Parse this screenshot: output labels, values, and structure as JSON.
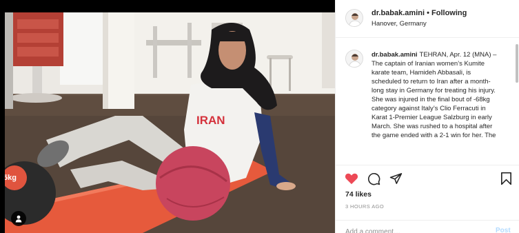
{
  "post": {
    "username": "dr.babak.amini",
    "separator": "•",
    "follow_status": "Following",
    "location": "Hanover, Germany",
    "caption_text": "TEHRAN, Apr. 12 (MNA) – The captain of Iranian women’s Kumite karate team, Hamideh Abbasali, is scheduled to return to Iran after a month-long stay in Germany for treating his injury. She was injured in the final bout of -68kg category against Italy’s Clio Ferracuti in Karat 1-Premier League Salzburg in early March. She was rushed to a hospital after the game ended with a 2-1 win for her. The",
    "likes": "74 likes",
    "timestamp": "3 HOURS AGO",
    "comment_placeholder": "Add a comment…",
    "post_button": "Post"
  },
  "photo": {
    "jersey_text": "IRAN",
    "ball_text": "5kg"
  },
  "icons": {
    "like": "heart-icon",
    "comment": "comment-icon",
    "share": "share-icon",
    "save": "bookmark-icon",
    "user_tag": "person-icon"
  },
  "colors": {
    "liked_heart": "#ed4956",
    "post_button_disabled": "#b3dbff",
    "muted_text": "#8e8e8e"
  }
}
